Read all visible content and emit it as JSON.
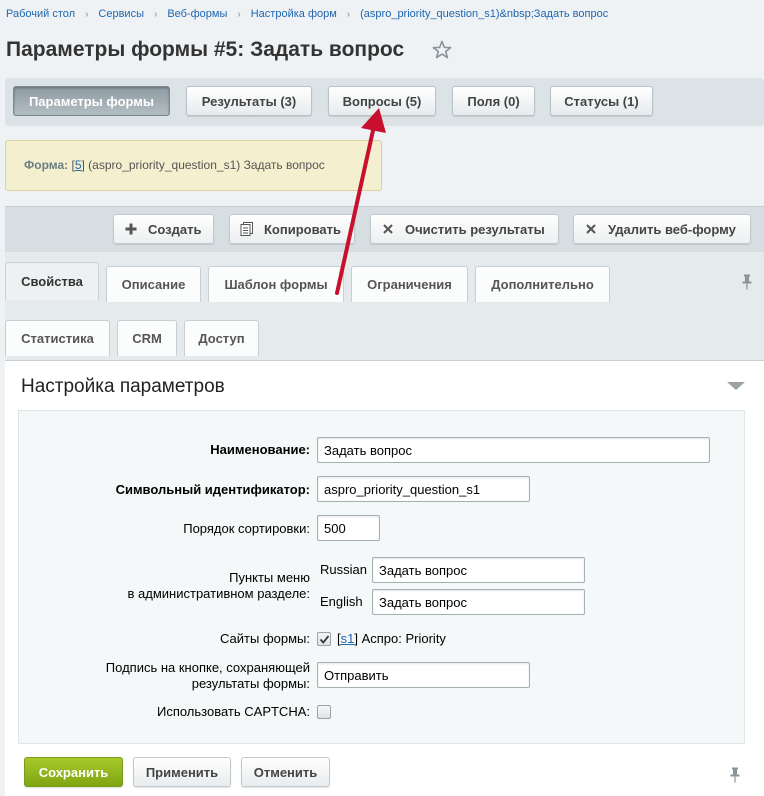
{
  "breadcrumb": {
    "items": [
      "Рабочий стол",
      "Сервисы",
      "Веб-формы",
      "Настройка форм",
      "(aspro_priority_question_s1)&nbsp;Задать вопрос"
    ],
    "separator": "›"
  },
  "page_title": "Параметры формы #5: Задать вопрос",
  "context_tabs": [
    {
      "label": "Параметры формы",
      "active": true
    },
    {
      "label": "Результаты (3)",
      "active": false
    },
    {
      "label": "Вопросы (5)",
      "active": false
    },
    {
      "label": "Поля (0)",
      "active": false
    },
    {
      "label": "Статусы (1)",
      "active": false
    }
  ],
  "notice": {
    "label": "Форма:",
    "id_link": "5",
    "text": "(aspro_priority_question_s1) Задать вопрос"
  },
  "toolbar": {
    "create": "Создать",
    "copy": "Копировать",
    "clear_results": "Очистить результаты",
    "delete_form": "Удалить веб-форму"
  },
  "tabs_row1": [
    "Свойства",
    "Описание",
    "Шаблон формы",
    "Ограничения",
    "Дополнительно"
  ],
  "tabs_row2": [
    "Статистика",
    "CRM",
    "Доступ"
  ],
  "section_title": "Настройка параметров",
  "form": {
    "name_label": "Наименование:",
    "name_value": "Задать вопрос",
    "sid_label": "Символьный идентификатор:",
    "sid_value": "aspro_priority_question_s1",
    "sort_label": "Порядок сортировки:",
    "sort_value": "500",
    "menu_label_line1": "Пункты меню",
    "menu_label_line2": "в административном разделе:",
    "menu_ru_lang": "Russian",
    "menu_ru_value": "Задать вопрос",
    "menu_en_lang": "English",
    "menu_en_value": "Задать вопрос",
    "sites_label": "Сайты формы:",
    "site_link": "s1",
    "site_name": "Аспро: Priority",
    "button_label_line1": "Подпись на кнопке, сохраняющей",
    "button_label_line2": "результаты формы:",
    "button_value": "Отправить",
    "captcha_label": "Использовать CAPTCHA:"
  },
  "bottom_buttons": {
    "save": "Сохранить",
    "apply": "Применить",
    "cancel": "Отменить"
  },
  "colors": {
    "accent": "#2067b0",
    "save_green": "#8db31c",
    "arrow_red": "#c8102e"
  }
}
